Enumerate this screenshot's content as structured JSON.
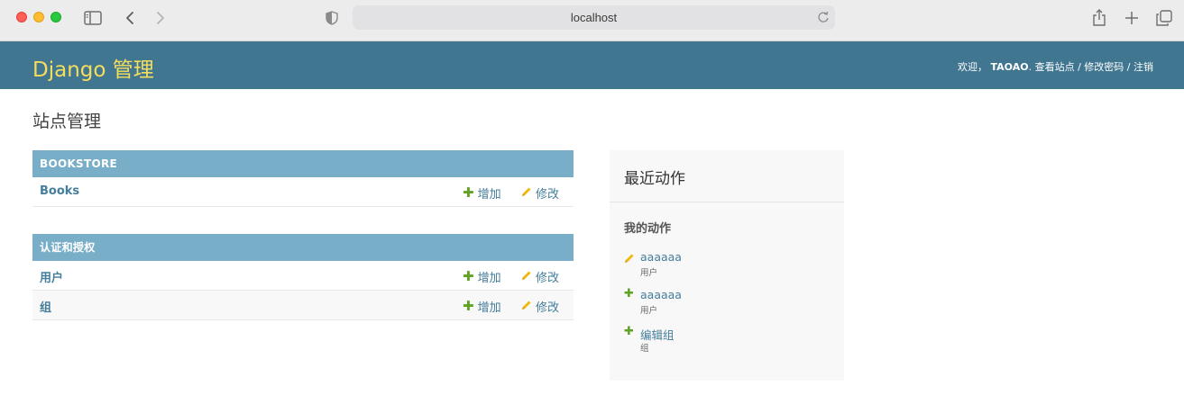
{
  "browser": {
    "url": "localhost"
  },
  "header": {
    "branding": "Django 管理",
    "welcome": "欢迎，",
    "username": "TAOAO",
    "sep1": ". ",
    "view_site": "查看站点",
    "sep2": " / ",
    "change_password": "修改密码",
    "sep3": " / ",
    "logout": "注销"
  },
  "page_title": "站点管理",
  "modules": [
    {
      "caption": "BOOKSTORE",
      "rows": [
        {
          "name": "Books",
          "add": "增加",
          "change": "修改"
        }
      ]
    },
    {
      "caption": "认证和授权",
      "rows": [
        {
          "name": "用户",
          "add": "增加",
          "change": "修改"
        },
        {
          "name": "组",
          "add": "增加",
          "change": "修改"
        }
      ]
    }
  ],
  "recent": {
    "title": "最近动作",
    "subtitle": "我的动作",
    "actions": [
      {
        "type": "change",
        "icon": "pencil-icon",
        "title": "aaaaaa",
        "meta": "用户"
      },
      {
        "type": "add",
        "icon": "plus-icon",
        "title": "aaaaaa",
        "meta": "用户"
      },
      {
        "type": "add",
        "icon": "plus-icon",
        "title": "编辑组",
        "meta": "组"
      }
    ]
  },
  "colors": {
    "header_bg": "#417690",
    "branding": "#f5dd5d",
    "caption_bg": "#79aec8",
    "link": "#447e9b",
    "add_green": "#5fa225",
    "pencil_yellow": "#efb80b"
  }
}
